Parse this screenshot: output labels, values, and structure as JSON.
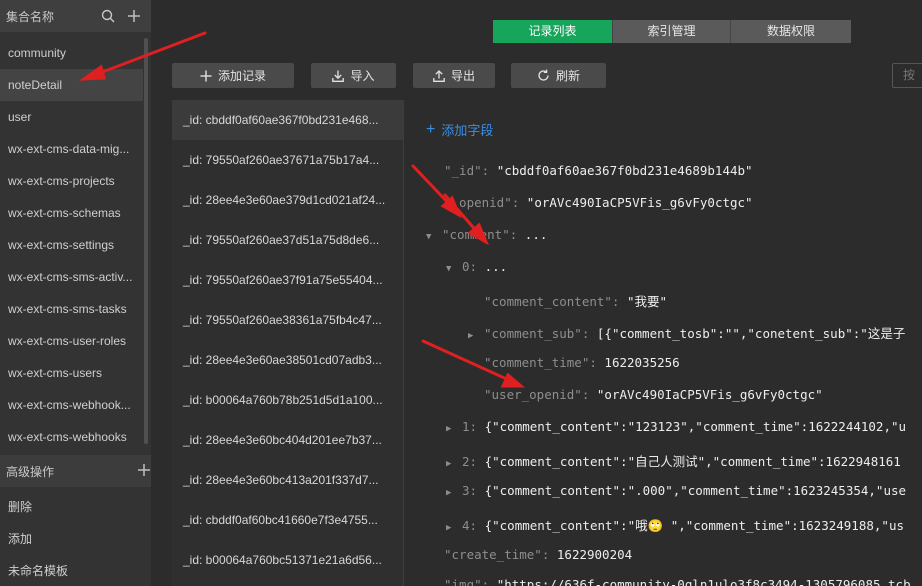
{
  "colors": {
    "accent": "#16a55a",
    "link": "#3a8ee6",
    "annotation": "#e02020"
  },
  "sidebar": {
    "collections_title": "集合名称",
    "collections": [
      "community",
      "noteDetail",
      "user",
      "wx-ext-cms-data-mig...",
      "wx-ext-cms-projects",
      "wx-ext-cms-schemas",
      "wx-ext-cms-settings",
      "wx-ext-cms-sms-activ...",
      "wx-ext-cms-sms-tasks",
      "wx-ext-cms-user-roles",
      "wx-ext-cms-users",
      "wx-ext-cms-webhook...",
      "wx-ext-cms-webhooks"
    ],
    "active_collection": "noteDetail",
    "advanced_title": "高级操作",
    "advanced_items": [
      "删除",
      "添加",
      "未命名模板"
    ]
  },
  "tabs": [
    {
      "label": "记录列表",
      "active": true
    },
    {
      "label": "索引管理",
      "active": false
    },
    {
      "label": "数据权限",
      "active": false
    }
  ],
  "toolbar": {
    "add_record": "添加记录",
    "import": "导入",
    "export": "导出",
    "refresh": "刷新",
    "search_placeholder": "按"
  },
  "records": [
    "_id: cbddf0af60ae367f0bd231e468...",
    "_id: 79550af260ae37671a75b17a4...",
    "_id: 28ee4e3e60ae379d1cd021af24...",
    "_id: 79550af260ae37d51a75d8de6...",
    "_id: 79550af260ae37f91a75e55404...",
    "_id: 79550af260ae38361a75fb4c47...",
    "_id: 28ee4e3e60ae38501cd07adb3...",
    "_id: b00064a760b78b251d5d1a100...",
    "_id: 28ee4e3e60bc404d201ee7b37...",
    "_id: 28ee4e3e60bc413a201f337d7...",
    "_id: cbddf0af60bc41660e7f3e4755...",
    "_id: b00064a760bc51371e21a6d56..."
  ],
  "detail": {
    "add_field": "添加字段",
    "id_key": "\"_id\":",
    "id_value": "\"cbddf0af60ae367f0bd231e4689b144b\"",
    "openid_key": "\"_openid\":",
    "openid_value": "\"orAVc490IaCP5VFis_g6vFy0ctgc\"",
    "comment_key": "\"comment\":",
    "comment_value": "...",
    "c0_index": "0:",
    "c0_value": "...",
    "cc_key": "\"comment_content\":",
    "cc_value": "\"我要\"",
    "cs_key": "\"comment_sub\":",
    "cs_value": "[{\"comment_tosb\":\"\",\"conetent_sub\":\"这是子",
    "ct_key": "\"comment_time\":",
    "ct_value": "1622035256",
    "uo_key": "\"user_openid\":",
    "uo_value": "\"orAVc490IaCP5VFis_g6vFy0ctgc\"",
    "c1_index": "1:",
    "c1_value": "{\"comment_content\":\"123123\",\"comment_time\":1622244102,\"u",
    "c2_index": "2:",
    "c2_value": "{\"comment_content\":\"自己人测试\",\"comment_time\":1622948161",
    "c3_index": "3:",
    "c3_value": "{\"comment_content\":\".000\",\"comment_time\":1623245354,\"use",
    "c4_index": "4:",
    "c4_value": "{\"comment_content\":\"哦🙄 \",\"comment_time\":1623249188,\"us",
    "create_key": "\"create_time\":",
    "create_value": "1622900204",
    "img_key": "\"img\":",
    "img_value": "\"https://636f-community-0gln1ulo3f8c3494-1305796085.tcb"
  }
}
